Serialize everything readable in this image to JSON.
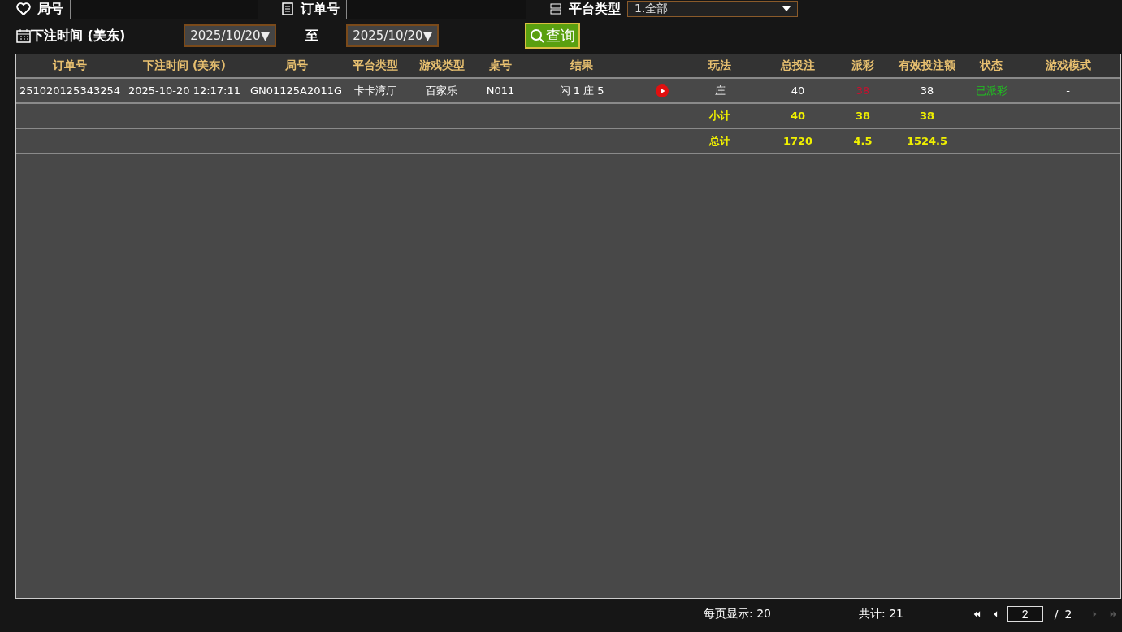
{
  "filters": {
    "round_label": "局号",
    "order_label": "订单号",
    "platform_label": "平台类型",
    "platform_value": "1.全部",
    "time_label": "下注时间 (美东)",
    "date_from": "2025/10/20▼",
    "to_label": "至",
    "date_to": "2025/10/20▼",
    "query_button": "查询"
  },
  "table": {
    "columns": [
      "订单号",
      "下注时间 (美东)",
      "局号",
      "平台类型",
      "游戏类型",
      "桌号",
      "结果",
      "",
      "玩法",
      "总投注",
      "派彩",
      "有效投注额",
      "状态",
      "游戏模式"
    ],
    "rows": [
      {
        "order": "251020125343254",
        "time": "2025-10-20 12:17:11",
        "round": "GN01125A2011G",
        "platform": "卡卡湾厅",
        "game": "百家乐",
        "table_no": "N011",
        "result": "闲 1 庄 5",
        "bet": "庄",
        "total": "40",
        "payout": "38",
        "valid": "38",
        "status": "已派彩",
        "mode": "-"
      }
    ],
    "summary": [
      {
        "label": "小计",
        "total": "40",
        "payout": "38",
        "valid": "38"
      },
      {
        "label": "总计",
        "total": "1720",
        "payout": "4.5",
        "valid": "1524.5"
      }
    ]
  },
  "pager": {
    "page_size": "每页显示: 20",
    "count": "共计: 21",
    "page": "2",
    "separator": "/",
    "pages": "2",
    "first_disabled": false,
    "prev_disabled": false,
    "next_disabled": true,
    "last_disabled": true
  }
}
